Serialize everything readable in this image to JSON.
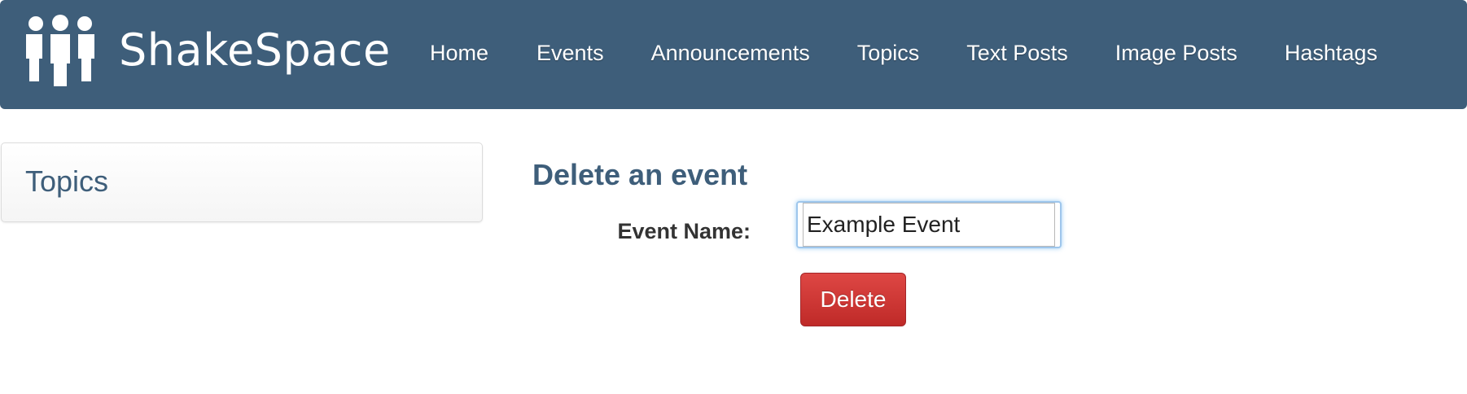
{
  "brand": {
    "name": "ShakeSpace",
    "logo_icon": "people-group-icon"
  },
  "nav": {
    "items": [
      {
        "label": "Home"
      },
      {
        "label": "Events"
      },
      {
        "label": "Announcements"
      },
      {
        "label": "Topics"
      },
      {
        "label": "Text Posts"
      },
      {
        "label": "Image Posts"
      },
      {
        "label": "Hashtags"
      }
    ]
  },
  "sidebar": {
    "title": "Topics"
  },
  "main": {
    "title": "Delete an event",
    "form": {
      "event_name_label": "Event Name:",
      "event_name_value": "Example Event",
      "delete_label": "Delete"
    }
  },
  "colors": {
    "navbar": "#3e5e7a",
    "heading": "#3e5e7a",
    "danger": "#cf3431"
  }
}
